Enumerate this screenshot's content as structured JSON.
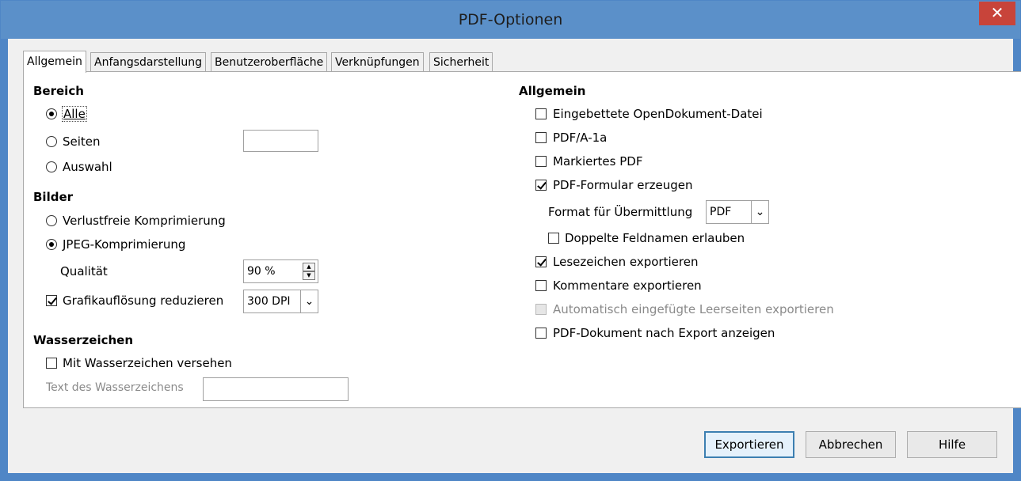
{
  "window": {
    "title": "PDF-Optionen",
    "close_glyph": "✕"
  },
  "tabs": [
    "Allgemein",
    "Anfangsdarstellung",
    "Benutzeroberfläche",
    "Verknüpfungen",
    "Sicherheit"
  ],
  "left": {
    "range_heading": "Bereich",
    "range_all": "Alle",
    "range_pages": "Seiten",
    "range_pages_value": "",
    "range_selection": "Auswahl",
    "images_heading": "Bilder",
    "lossless": "Verlustfreie Komprimierung",
    "jpeg": "JPEG-Komprimierung",
    "quality_label": "Qualität",
    "quality_value": "90 %",
    "reduce_resolution": "Grafikauflösung reduzieren",
    "resolution_value": "300 DPI",
    "watermark_heading": "Wasserzeichen",
    "watermark_checkbox": "Mit Wasserzeichen versehen",
    "watermark_text_label": "Text des Wasserzeichens",
    "watermark_text_value": ""
  },
  "right": {
    "general_heading": "Allgemein",
    "embed_odf": "Eingebettete OpenDokument-Datei",
    "pdfa": "PDF/A-1a",
    "tagged_pdf": "Markiertes PDF",
    "create_form": "PDF-Formular erzeugen",
    "submit_format_label": "Format für Übermittlung",
    "submit_format_value": "PDF",
    "duplicate_names": "Doppelte Feldnamen erlauben",
    "export_bookmarks": "Lesezeichen exportieren",
    "export_comments": "Kommentare exportieren",
    "export_blank_pages": "Automatisch eingefügte Leerseiten exportieren",
    "view_after_export": "PDF-Dokument nach Export anzeigen"
  },
  "buttons": {
    "export": "Exportieren",
    "cancel": "Abbrechen",
    "help": "Hilfe"
  },
  "state": {
    "range": "all",
    "compression": "jpeg",
    "reduce_resolution": true,
    "watermark": false,
    "embed_odf": false,
    "pdfa": false,
    "tagged_pdf": false,
    "create_form": true,
    "duplicate_names": false,
    "export_bookmarks": true,
    "export_comments": false,
    "export_blank_pages_disabled": true,
    "view_after_export": false
  },
  "colors": {
    "titlebar": "#5b90c9",
    "close": "#c8443a",
    "default_button_border": "#3c7fb1"
  }
}
